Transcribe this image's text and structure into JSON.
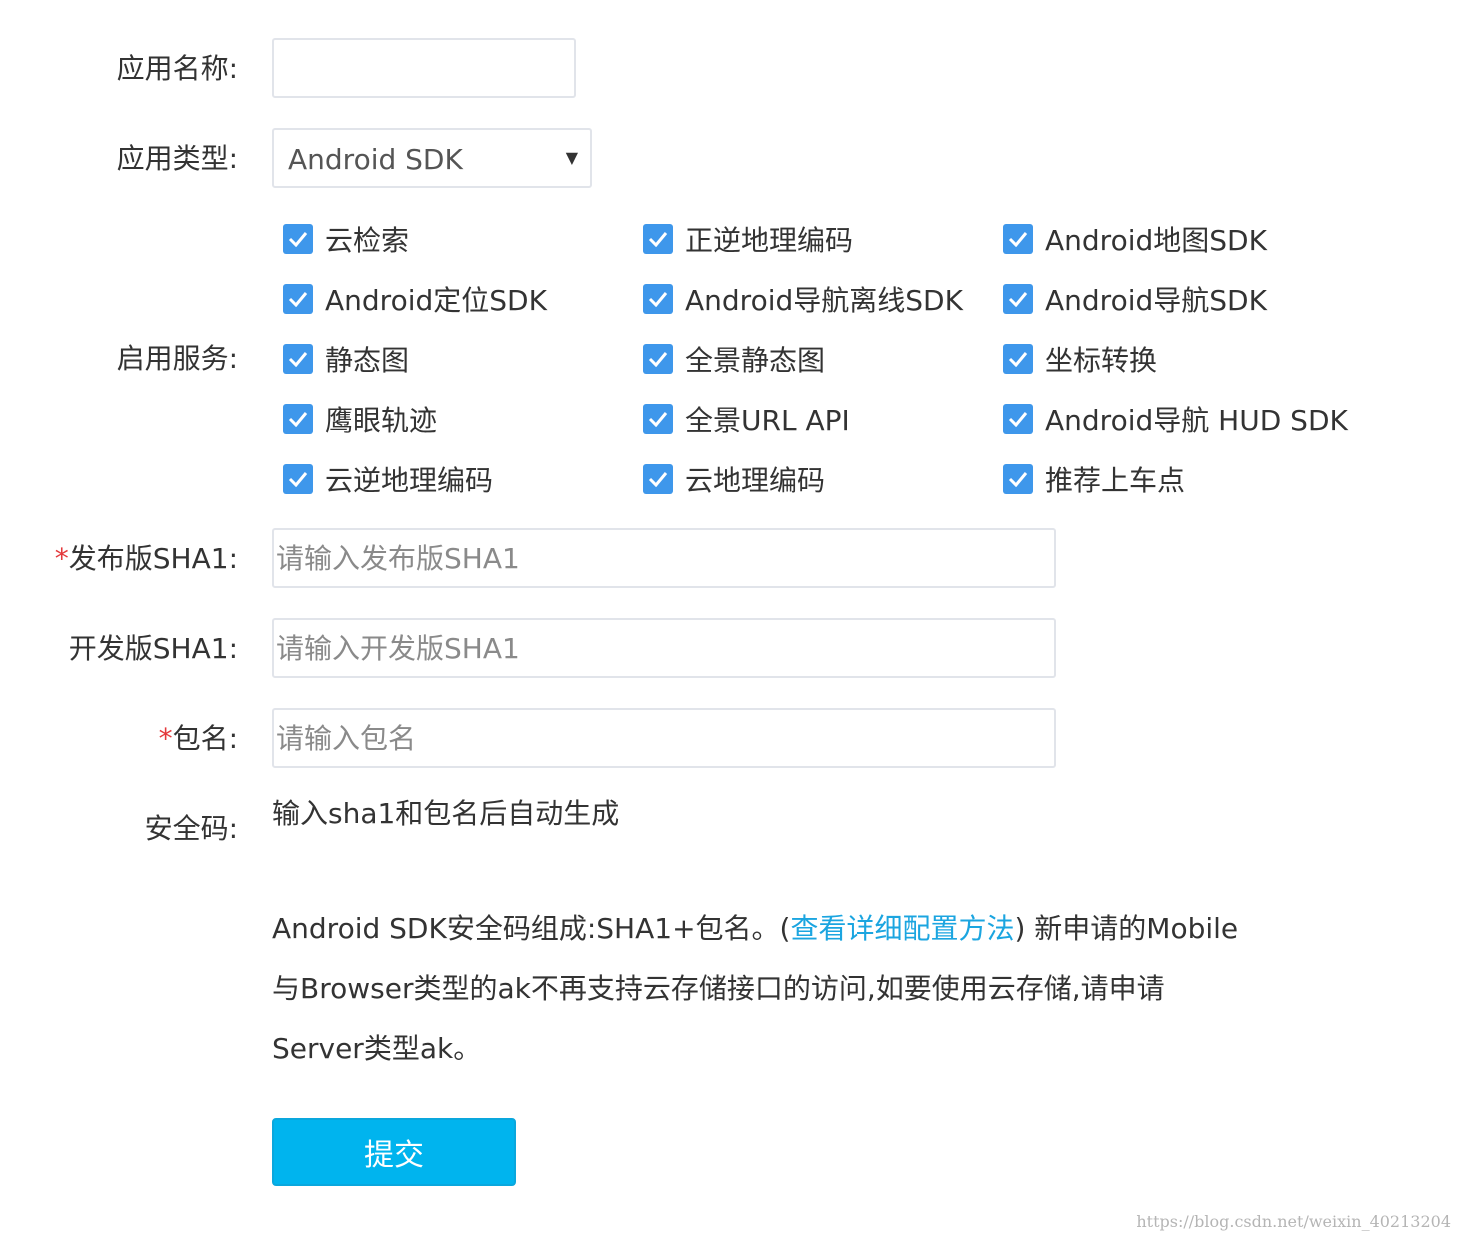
{
  "form": {
    "app_name": {
      "label": "应用名称:",
      "value": ""
    },
    "app_type": {
      "label": "应用类型:",
      "selected": "Android SDK"
    },
    "services": {
      "label": "启用服务:",
      "items": [
        {
          "label": "云检索",
          "checked": true
        },
        {
          "label": "正逆地理编码",
          "checked": true
        },
        {
          "label": "Android地图SDK",
          "checked": true
        },
        {
          "label": "Android定位SDK",
          "checked": true
        },
        {
          "label": "Android导航离线SDK",
          "checked": true
        },
        {
          "label": "Android导航SDK",
          "checked": true
        },
        {
          "label": "静态图",
          "checked": true
        },
        {
          "label": "全景静态图",
          "checked": true
        },
        {
          "label": "坐标转换",
          "checked": true
        },
        {
          "label": "鹰眼轨迹",
          "checked": true
        },
        {
          "label": "全景URL API",
          "checked": true
        },
        {
          "label": "Android导航 HUD SDK",
          "checked": true
        },
        {
          "label": "云逆地理编码",
          "checked": true
        },
        {
          "label": "云地理编码",
          "checked": true
        },
        {
          "label": "推荐上车点",
          "checked": true
        }
      ]
    },
    "release_sha1": {
      "required_mark": "*",
      "label": "发布版SHA1:",
      "placeholder": "请输入发布版SHA1"
    },
    "dev_sha1": {
      "label": "开发版SHA1:",
      "placeholder": "请输入开发版SHA1"
    },
    "package_name": {
      "required_mark": "*",
      "label": "包名:",
      "placeholder": "请输入包名"
    },
    "security_code": {
      "label": "安全码:",
      "value": "输入sha1和包名后自动生成"
    }
  },
  "note": {
    "line1_prefix": "Android SDK安全码组成:SHA1+包名。(",
    "link": "查看详细配置方法",
    "line1_suffix": ") 新申请的Mobile",
    "line2": "与Browser类型的ak不再支持云存储接口的访问,如要使用云存储,请申请",
    "line3": "Server类型ak。"
  },
  "submit_label": "提交",
  "watermark": "https://blog.csdn.net/weixin_40213204",
  "colors": {
    "accent": "#3e97eb",
    "button": "#00b4ee",
    "link": "#1ba5e0",
    "required": "#e4393c"
  }
}
